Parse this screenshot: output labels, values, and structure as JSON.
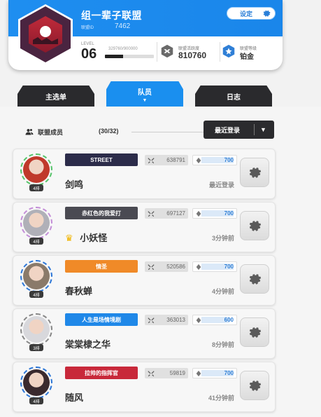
{
  "header": {
    "guild_name": "组一辈子联盟",
    "guild_id_label": "联盟ID",
    "guild_id": "7462",
    "settings_label": "设定",
    "level_label": "LEVEL",
    "level": "06",
    "exp_text": "329760/900000",
    "exp_progress": 0.37,
    "activity_label": "联盟活跃度",
    "activity_value": "810760",
    "rank_label": "联盟等级",
    "rank_value": "铂金"
  },
  "tabs": [
    {
      "label": "主选单",
      "active": false
    },
    {
      "label": "队员",
      "active": true
    },
    {
      "label": "日志",
      "active": false
    }
  ],
  "members_header": {
    "label": "联盟成员",
    "count": "(30/32)",
    "sort_label": "最近登录"
  },
  "members": [
    {
      "name": "剑鸣",
      "level": "4排",
      "title": "STREET",
      "title_color": "#2c2c4a",
      "power": "638791",
      "contribution": "700",
      "contribution_progress": 1.0,
      "last_login": "最近登录",
      "leader": false,
      "avatar_color": "#c0392b",
      "ring_color": "#58c46c"
    },
    {
      "name": "小妖怪",
      "level": "4排",
      "title": "赤红色的我爱打",
      "title_color": "#4a4a52",
      "power": "697127",
      "contribution": "700",
      "contribution_progress": 1.0,
      "last_login": "3分钟前",
      "leader": true,
      "avatar_color": "#b0b0b8",
      "ring_color": "#c48fd8"
    },
    {
      "name": "春秋蝉",
      "level": "4排",
      "title": "情圣",
      "title_color": "#f08a28",
      "power": "520586",
      "contribution": "700",
      "contribution_progress": 1.0,
      "last_login": "4分钟前",
      "leader": false,
      "avatar_color": "#8a7a6a",
      "ring_color": "#2f78d8"
    },
    {
      "name": "棠棠棣之华",
      "level": "3排",
      "title": "人生是场情境剧",
      "title_color": "#1f88e8",
      "power": "363013",
      "contribution": "600",
      "contribution_progress": 0.86,
      "last_login": "8分钟前",
      "leader": false,
      "avatar_color": "#d8d8dc",
      "ring_color": "#888888"
    },
    {
      "name": "随风",
      "level": "4排",
      "title": "拉帅的指挥官",
      "title_color": "#c8283a",
      "power": "59819",
      "contribution": "700",
      "contribution_progress": 1.0,
      "last_login": "41分钟前",
      "leader": false,
      "avatar_color": "#3a2a2e",
      "ring_color": "#2f78d8"
    }
  ],
  "colors": {
    "accent": "#1a8fef",
    "dark": "#2b2b2e"
  }
}
